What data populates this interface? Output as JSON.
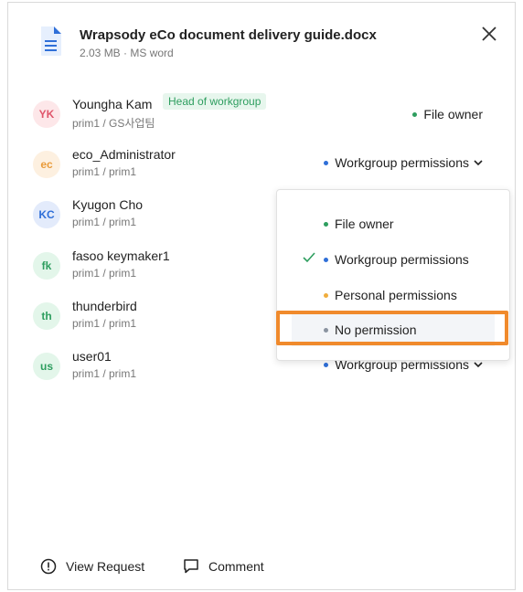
{
  "file": {
    "title": "Wrapsody eCo document delivery guide.docx",
    "meta": "2.03 MB · MS word",
    "icon": "document-icon"
  },
  "members": [
    {
      "initials": "YK",
      "name": "Youngha Kam",
      "tag": "Head of workgroup",
      "sub": "prim1 / GS사업팀",
      "permission": "File owner",
      "avatar_bg": "#fde7e9",
      "avatar_fg": "#e0566b",
      "dot": "#2e9e5f"
    },
    {
      "initials": "ec",
      "name": "eco_Administrator",
      "sub": "prim1  / prim1",
      "permission": "Workgroup permissions",
      "avatar_bg": "#fdf0e0",
      "avatar_fg": "#e99b3a",
      "dot": "#2f6fd8"
    },
    {
      "initials": "KC",
      "name": "Kyugon Cho",
      "sub": "prim1  / prim1",
      "avatar_bg": "#e3ebfb",
      "avatar_fg": "#2f6fd8"
    },
    {
      "initials": "fk",
      "name": "fasoo keymaker1",
      "sub": "prim1  / prim1",
      "avatar_bg": "#e3f6ea",
      "avatar_fg": "#2e9e5f"
    },
    {
      "initials": "th",
      "name": "thunderbird",
      "sub": "prim1  / prim1",
      "avatar_bg": "#e3f6ea",
      "avatar_fg": "#2e9e5f"
    },
    {
      "initials": "us",
      "name": "user01",
      "sub": "prim1  / prim1",
      "permission": "Workgroup permissions",
      "avatar_bg": "#e3f6ea",
      "avatar_fg": "#2e9e5f",
      "dot": "#2f6fd8"
    }
  ],
  "dropdown": {
    "options": [
      {
        "label": "File owner",
        "dot": "#2e9e5f"
      },
      {
        "label": "Workgroup permissions",
        "dot": "#2f6fd8",
        "selected": true
      },
      {
        "label": "Personal permissions",
        "dot": "#f0ad3d"
      },
      {
        "label": "No permission",
        "dot": "#8a93a0",
        "highlighted": true
      }
    ]
  },
  "footer": {
    "view_request": "View Request",
    "comment": "Comment"
  },
  "colors": {
    "highlight": "#f08a2c",
    "check": "#2e9e5f"
  }
}
